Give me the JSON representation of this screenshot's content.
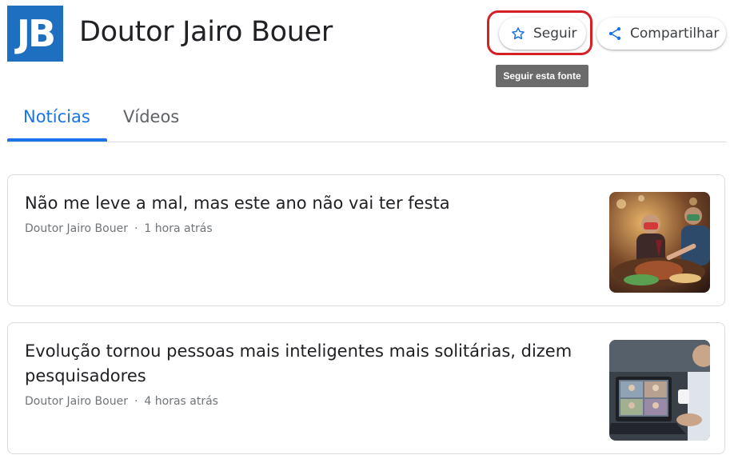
{
  "header": {
    "logo_text": "JB",
    "title": "Doutor Jairo Bouer",
    "follow_label": "Seguir",
    "share_label": "Compartilhar",
    "tooltip": "Seguir esta fonte"
  },
  "colors": {
    "accent": "#1a73e8",
    "logo_bg": "#1f6fc0",
    "highlight_border": "#d62027"
  },
  "icons": {
    "follow": "star-outline-icon",
    "share": "share-icon"
  },
  "tabs": [
    {
      "label": "Notícias",
      "active": true
    },
    {
      "label": "Vídeos",
      "active": false
    }
  ],
  "articles": [
    {
      "headline": "Não me leve a mal, mas este ano não vai ter festa",
      "source": "Doutor Jairo Bouer",
      "separator": "·",
      "time": "1 hora atrás"
    },
    {
      "headline": "Evolução tornou pessoas mais inteligentes mais solitárias, dizem pesquisadores",
      "source": "Doutor Jairo Bouer",
      "separator": "·",
      "time": "4 horas atrás"
    }
  ]
}
